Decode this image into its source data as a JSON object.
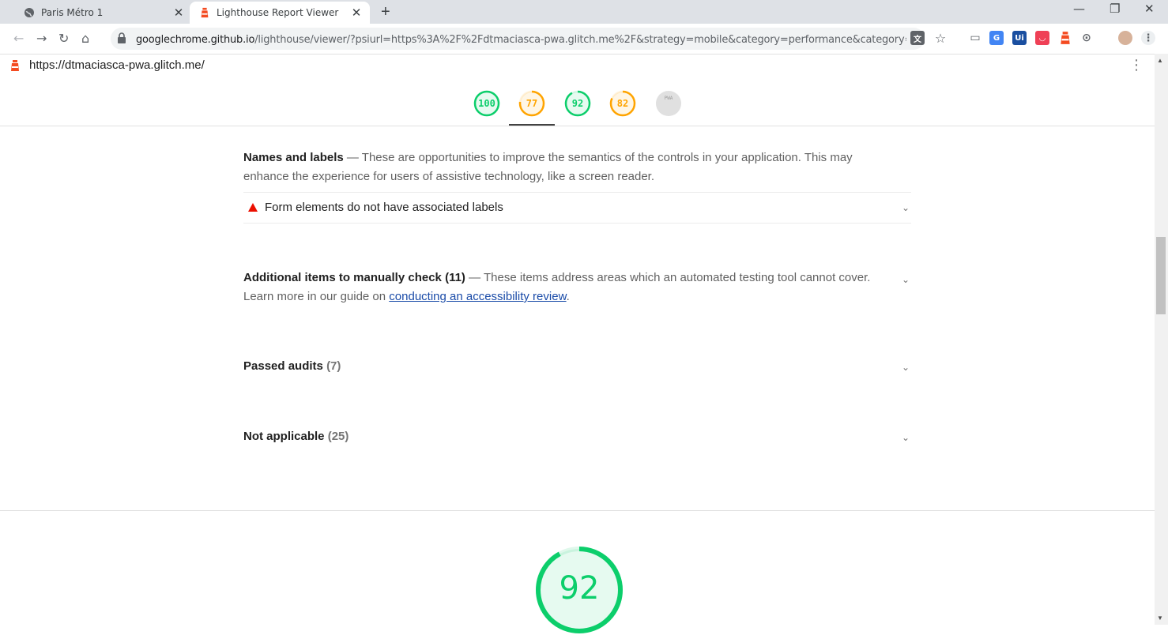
{
  "browser": {
    "tabs": [
      {
        "title": "Paris Métro 1",
        "active": false
      },
      {
        "title": "Lighthouse Report Viewer",
        "active": true
      }
    ],
    "new_tab": "+",
    "url": {
      "host": "googlechrome.github.io",
      "path": "/lighthouse/viewer/?psiurl=https%3A%2F%2Fdtmaciasca-pwa.glitch.me%2F&strategy=mobile&category=performance&category=access..."
    },
    "extensions": [
      "translate-icon",
      "star-icon",
      "cast-icon",
      "extension-icon",
      "ui-icon",
      "pocket-icon",
      "lighthouse-icon",
      "code-icon"
    ]
  },
  "report": {
    "page_url": "https://dtmaciasca-pwa.glitch.me/",
    "gauges": [
      {
        "label": "100",
        "score": 100,
        "color": "#0cce6b"
      },
      {
        "label": "77",
        "score": 77,
        "color": "#ffa400"
      },
      {
        "label": "92",
        "score": 92,
        "color": "#0cce6b"
      },
      {
        "label": "82",
        "score": 82,
        "color": "#ffa400"
      },
      {
        "label": "PWA",
        "color": "#bdbdbd"
      }
    ],
    "names_labels": {
      "title": "Names and labels",
      "description": " — These are opportunities to improve the semantics of the controls in your application. This may enhance the experience for users of assistive technology, like a screen reader."
    },
    "failed_audit": "Form elements do not have associated labels",
    "manual": {
      "title": "Additional items to manually check",
      "count": "(11)",
      "description": " — These items address areas which an automated testing tool cannot cover. Learn more in our guide on ",
      "link_text": "conducting an accessibility review",
      "suffix": "."
    },
    "passed": {
      "title": "Passed audits",
      "count": "(7)"
    },
    "not_applicable": {
      "title": "Not applicable",
      "count": "(25)"
    },
    "big_score": "92",
    "big_score_value": 92,
    "colors": {
      "pass": "#0cce6b",
      "average": "#ffa400",
      "fail": "#eb0f00",
      "link": "#1a4ba8"
    }
  }
}
